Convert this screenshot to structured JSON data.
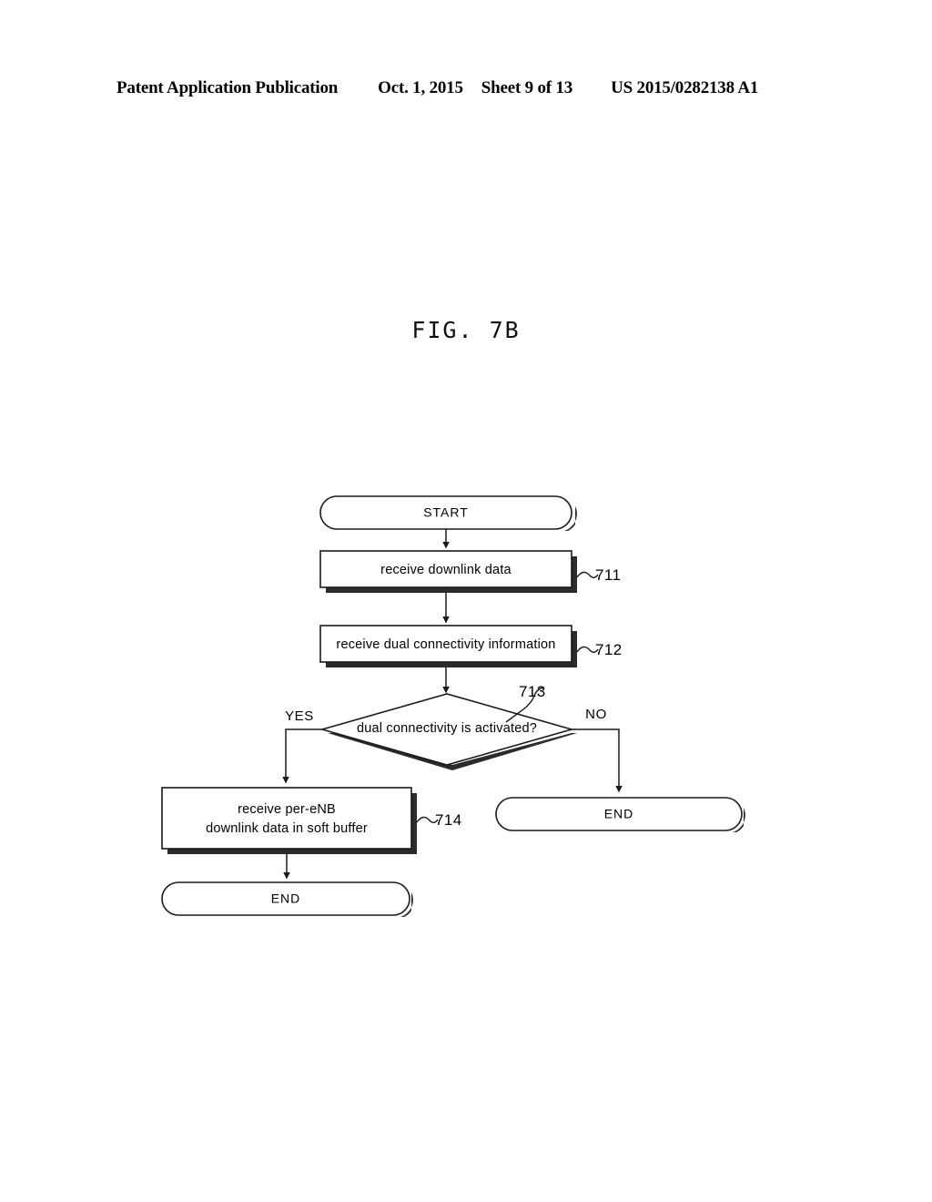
{
  "header": {
    "publication": "Patent Application Publication",
    "date": "Oct. 1, 2015",
    "sheet": "Sheet 9 of 13",
    "patent_number": "US 2015/0282138 A1"
  },
  "figure": {
    "title": "FIG. 7B"
  },
  "flowchart": {
    "nodes": {
      "start": {
        "label": "START",
        "shape": "terminator"
      },
      "step_711": {
        "label": "receive downlink data",
        "shape": "process",
        "ref": "711"
      },
      "step_712": {
        "label": "receive dual connectivity information",
        "shape": "process",
        "ref": "712"
      },
      "decision_713": {
        "label": "dual connectivity is activated?",
        "shape": "decision",
        "ref": "713"
      },
      "step_714": {
        "label_line1": "receive per-eNB",
        "label_line2": "downlink data in soft buffer",
        "shape": "process",
        "ref": "714"
      },
      "end_yes": {
        "label": "END",
        "shape": "terminator"
      },
      "end_no": {
        "label": "END",
        "shape": "terminator"
      }
    },
    "branches": {
      "yes": "YES",
      "no": "NO"
    },
    "colors": {
      "stroke": "#1a1a1a",
      "fill": "#ffffff",
      "shadow": "#2b2b2b",
      "background": "#ffffff"
    }
  }
}
